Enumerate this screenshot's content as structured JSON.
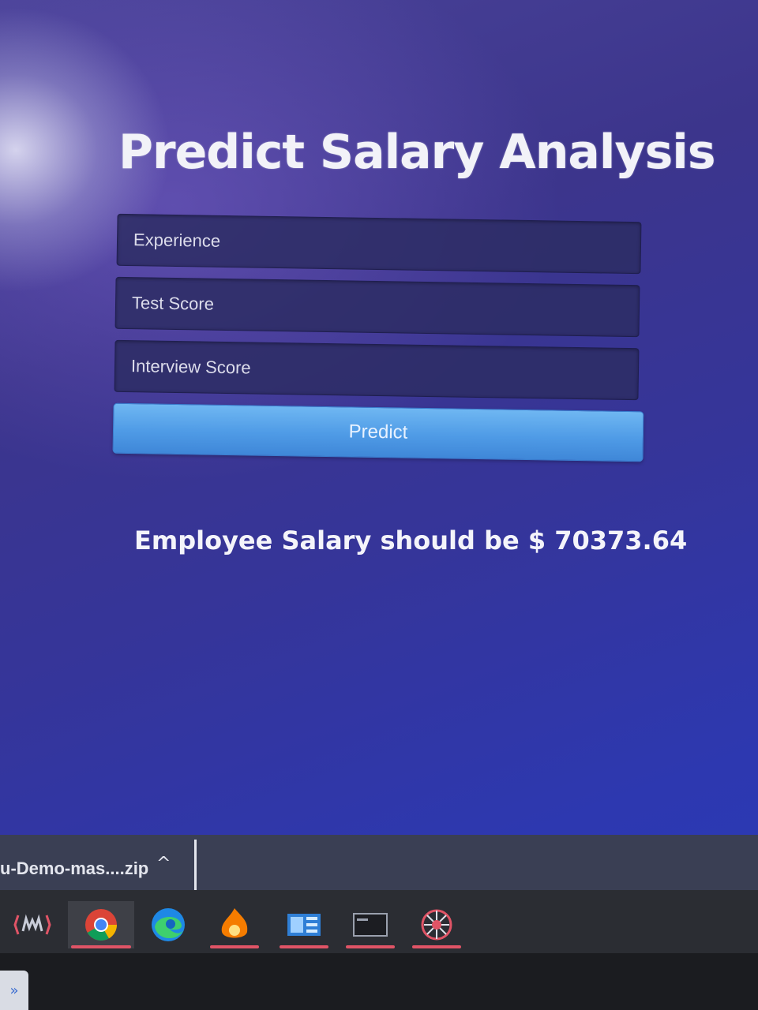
{
  "page": {
    "title": "Predict Salary Analysis"
  },
  "form": {
    "experience_placeholder": "Experience",
    "test_score_placeholder": "Test Score",
    "interview_score_placeholder": "Interview Score",
    "predict_label": "Predict"
  },
  "result": {
    "text": "Employee Salary should be $ 70373.64"
  },
  "download_bar": {
    "file_name": "u-Demo-mas....zip",
    "chevron": "^"
  },
  "taskbar": {
    "apps": [
      {
        "icon": "predator-sense-icon"
      },
      {
        "icon": "chrome-icon",
        "active": true
      },
      {
        "icon": "edge-icon"
      },
      {
        "icon": "orange-app-icon"
      },
      {
        "icon": "window-app-icon"
      },
      {
        "icon": "terminal-icon"
      },
      {
        "icon": "network-app-icon"
      }
    ]
  },
  "colors": {
    "background": "#3c358c",
    "button": "#4f9be6",
    "taskbar_indicator": "#e05466"
  }
}
